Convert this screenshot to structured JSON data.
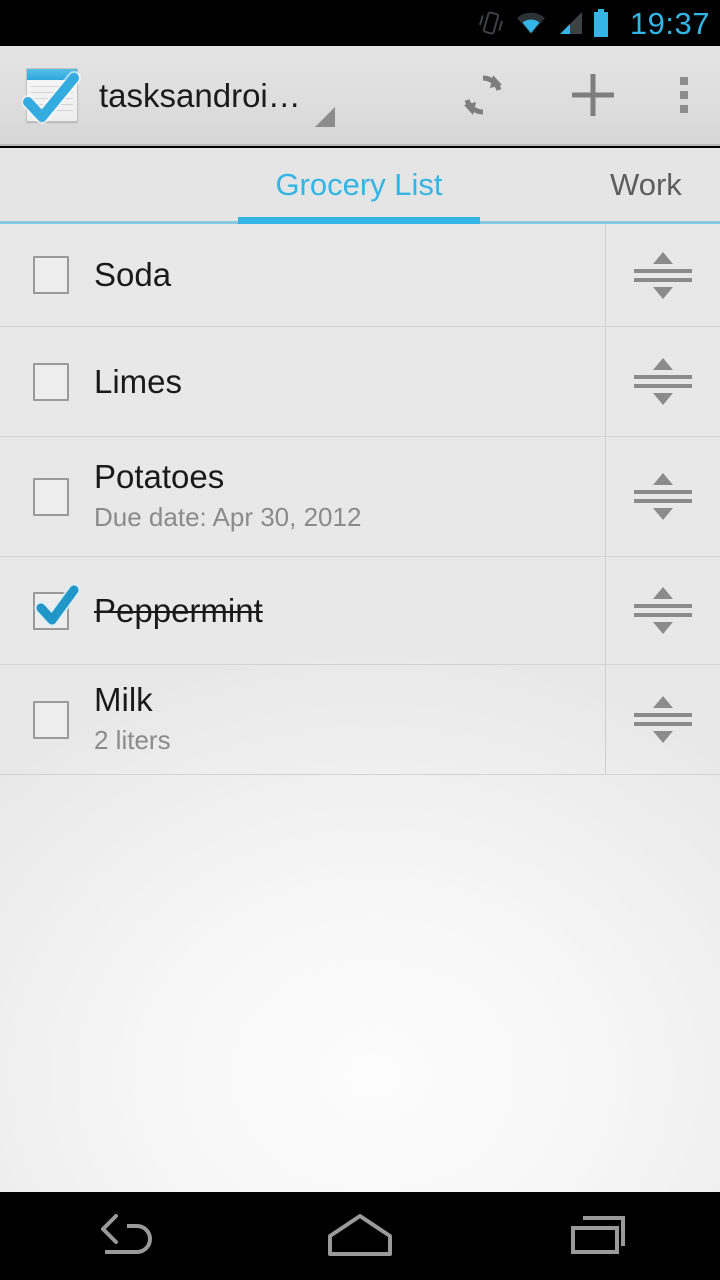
{
  "status_bar": {
    "time": "19:37",
    "icons": [
      "vibrate-icon",
      "wifi-icon",
      "cellular-signal-icon",
      "battery-icon"
    ],
    "accent_color": "#33b5e5",
    "background": "#000000"
  },
  "action_bar": {
    "app_icon": "tasks-notepad-check-icon",
    "title": "tasksandroi…",
    "spinner_indicator": "dropdown-triangle-icon",
    "actions": [
      {
        "name": "refresh-icon",
        "label": "Refresh"
      },
      {
        "name": "add-icon",
        "label": "Add"
      },
      {
        "name": "overflow-menu-icon",
        "label": "More options"
      }
    ]
  },
  "tabs": {
    "active_index": 0,
    "indicator_color": "#33b5e5",
    "items": [
      {
        "label": "Grocery List",
        "active": true
      },
      {
        "label": "Work",
        "active": false
      }
    ]
  },
  "task_list": {
    "items": [
      {
        "title": "Soda",
        "subtitle": "",
        "checked": false
      },
      {
        "title": "Limes",
        "subtitle": "",
        "checked": false
      },
      {
        "title": "Potatoes",
        "subtitle": "Due date: Apr 30, 2012",
        "checked": false
      },
      {
        "title": "Peppermint",
        "subtitle": "",
        "checked": true
      },
      {
        "title": "Milk",
        "subtitle": "2 liters",
        "checked": false
      }
    ],
    "reorder_handle": "drag-reorder-icon"
  },
  "navigation_bar": {
    "buttons": [
      {
        "name": "back-button",
        "label": "Back"
      },
      {
        "name": "home-button",
        "label": "Home"
      },
      {
        "name": "recents-button",
        "label": "Recent apps"
      }
    ]
  }
}
